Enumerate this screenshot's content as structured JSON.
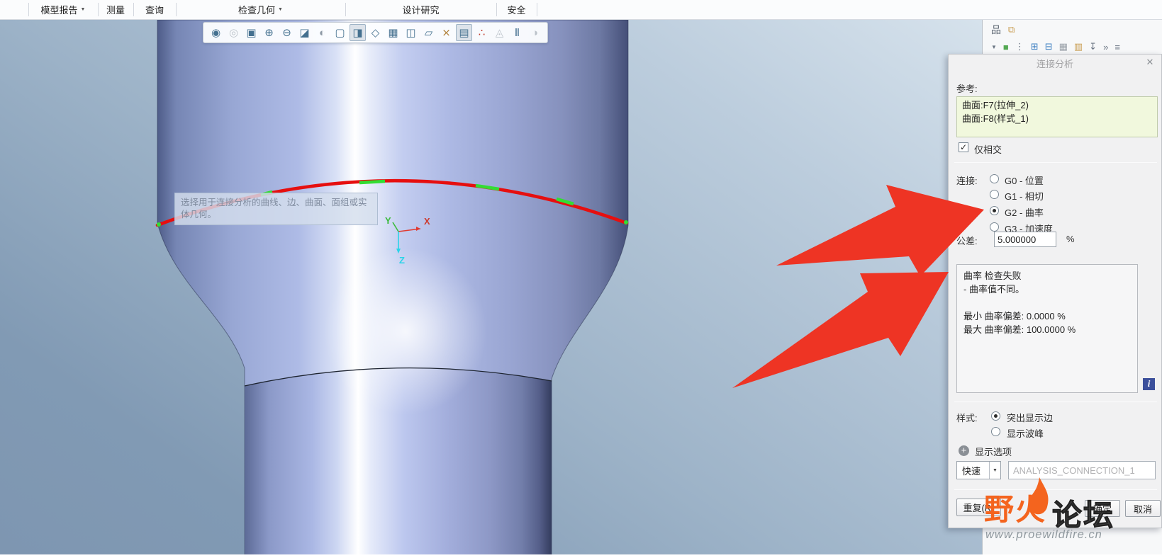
{
  "ribbon": {
    "tabs": [
      {
        "label": "模型报告",
        "caret": "▼"
      },
      {
        "label": "测量",
        "caret": ""
      },
      {
        "label": "查询",
        "caret": ""
      },
      {
        "label": "检查几何",
        "caret": "▼"
      },
      {
        "label": "设计研究",
        "caret": ""
      },
      {
        "label": "安全",
        "caret": ""
      }
    ]
  },
  "graphics_toolbar": {
    "icons": [
      {
        "name": "view-manager-icon",
        "glyph": "◉"
      },
      {
        "name": "saved-orientations-icon",
        "glyph": "◎"
      },
      {
        "name": "zoom-region-icon",
        "glyph": "▣"
      },
      {
        "name": "zoom-in-icon",
        "glyph": "⊕"
      },
      {
        "name": "zoom-out-icon",
        "glyph": "⊖"
      },
      {
        "name": "refit-icon",
        "glyph": "◪"
      },
      {
        "name": "shading-icon",
        "glyph": "◐"
      },
      {
        "name": "named-views-icon",
        "glyph": "▢"
      },
      {
        "name": "view-normal-icon",
        "glyph": "◨"
      },
      {
        "name": "appearance-gallery-icon",
        "glyph": "◇"
      },
      {
        "name": "capture-icon",
        "glyph": "▦"
      },
      {
        "name": "display-style-icon",
        "glyph": "◫"
      },
      {
        "name": "plane-display-icon",
        "glyph": "▱"
      },
      {
        "name": "axis-display-icon",
        "glyph": "⨯"
      },
      {
        "name": "annotation-display-icon",
        "glyph": "▤"
      },
      {
        "name": "csys-display-icon",
        "glyph": "∴"
      },
      {
        "name": "analysis-preview-icon",
        "glyph": "◬"
      },
      {
        "name": "pause-icon",
        "glyph": "Ⅱ"
      },
      {
        "name": "spin-center-icon",
        "glyph": "◑"
      }
    ]
  },
  "tree_pane": {
    "row1": [
      {
        "name": "model-tree-icon",
        "glyph": "品"
      },
      {
        "name": "folder-browser-icon",
        "glyph": "⧉"
      }
    ],
    "row2": [
      {
        "name": "filter-caret-icon",
        "glyph": "▼"
      },
      {
        "name": "model-node-icon",
        "glyph": "■"
      },
      {
        "name": "more-options-icon",
        "glyph": "⋮"
      },
      {
        "name": "expand-tree-icon",
        "glyph": "⊞"
      },
      {
        "name": "collapse-tree-icon",
        "glyph": "⊟"
      },
      {
        "name": "show-window-icon",
        "glyph": "▦"
      },
      {
        "name": "new-folder-icon",
        "glyph": "▥"
      },
      {
        "name": "pin-icon",
        "glyph": "↧"
      },
      {
        "name": "overflow-icon",
        "glyph": "»"
      },
      {
        "name": "settings-list-icon",
        "glyph": "≡"
      }
    ]
  },
  "viewport": {
    "tooltip_line1": "选择用于连接分析的曲线、边、曲面、面组或实",
    "tooltip_line2": "体几何。",
    "axes": {
      "x": "X",
      "y": "Y",
      "z": "Z"
    },
    "colors": {
      "curve_red": "#e60f0f",
      "curve_green": "#33dd33",
      "axis_x": "#cc3b30",
      "axis_y": "#3dbb3d",
      "axis_z": "#2ad4e8"
    }
  },
  "dialog": {
    "title": "连接分析",
    "close_glyph": "✕",
    "reference_label": "参考:",
    "references": [
      "曲面:F7(拉伸_2)",
      "曲面:F8(样式_1)"
    ],
    "check_glyph": "✓",
    "intersect_only_label": "仅相交",
    "connection_label": "连接:",
    "connection_options": [
      {
        "label": "G0 - 位置",
        "selected": false
      },
      {
        "label": "G1 - 相切",
        "selected": false
      },
      {
        "label": "G2 - 曲率",
        "selected": true
      },
      {
        "label": "G3 - 加速度",
        "selected": false
      }
    ],
    "tolerance_label": "公差:",
    "tolerance_value": "5.000000",
    "tolerance_unit": "%",
    "results_text": "曲率 检查失败\n- 曲率值不同。\n\n最小 曲率偏差: 0.0000 %\n最大 曲率偏差: 100.0000 %",
    "info_glyph": "i",
    "style_label": "样式:",
    "style_options": [
      {
        "label": "突出显示边",
        "selected": true
      },
      {
        "label": "显示波峰",
        "selected": false
      }
    ],
    "display_options_glyph": "+",
    "display_options_label": "显示选项",
    "quick_label": "快速",
    "quick_caret": "▼",
    "analysis_name": "ANALYSIS_CONNECTION_1",
    "buttons": {
      "repeat": "重复(R)",
      "ok": "确定",
      "cancel": "取消"
    }
  },
  "annotation": {
    "arrow_color": "#ee3424"
  },
  "watermark": {
    "brand_orange": "野火",
    "brand_dark": "论坛",
    "url": "www.proewildfire.cn"
  }
}
